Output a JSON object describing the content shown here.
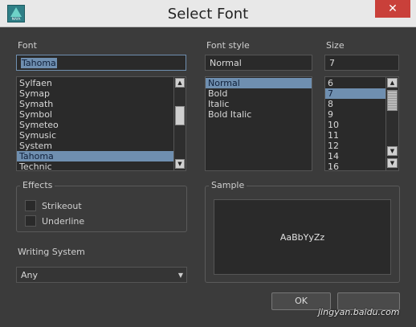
{
  "window": {
    "title": "Select Font",
    "close_icon": "✕",
    "app_icon_text": "MAYA"
  },
  "font": {
    "label": "Font",
    "value": "Tahoma",
    "items": [
      "Sylfaen",
      "Symap",
      "Symath",
      "Symbol",
      "Symeteo",
      "Symusic",
      "System",
      "Tahoma",
      "Technic"
    ],
    "selected_index": 7
  },
  "font_style": {
    "label": "Font style",
    "value": "Normal",
    "items": [
      "Normal",
      "Bold",
      "Italic",
      "Bold Italic"
    ],
    "selected_index": 0
  },
  "size": {
    "label": "Size",
    "value": "7",
    "items": [
      "6",
      "7",
      "8",
      "9",
      "10",
      "11",
      "12",
      "14",
      "16"
    ],
    "selected_index": 1
  },
  "effects": {
    "title": "Effects",
    "strikeout_label": "Strikeout",
    "underline_label": "Underline"
  },
  "writing_system": {
    "label": "Writing System",
    "value": "Any"
  },
  "sample": {
    "title": "Sample",
    "text": "AaBbYyZz"
  },
  "buttons": {
    "ok": "OK"
  },
  "watermark": "jingyan.baidu.com",
  "colors": {
    "selection": "#6f8fb0",
    "close": "#c9403a",
    "background": "#3b3b3b"
  }
}
